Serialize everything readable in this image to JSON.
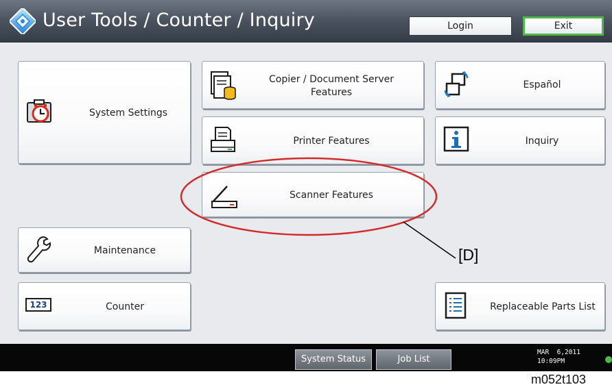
{
  "header": {
    "title": "User Tools / Counter / Inquiry",
    "logo_icon": "diamond-logo-icon",
    "login_label": "Login",
    "exit_label": "Exit",
    "exit_border_color": "#4fb848"
  },
  "menu": {
    "system_settings": {
      "label": "System Settings",
      "icon": "system-settings-icon"
    },
    "copier": {
      "label_line1": "Copier / Document Server",
      "label_line2": "Features",
      "icon": "copier-icon"
    },
    "printer": {
      "label": "Printer Features",
      "icon": "printer-icon"
    },
    "scanner": {
      "label": "Scanner Features",
      "icon": "scanner-icon"
    },
    "language": {
      "label": "Español",
      "icon": "language-switch-icon"
    },
    "inquiry": {
      "label": "Inquiry",
      "icon": "info-icon"
    },
    "maintenance": {
      "label": "Maintenance",
      "icon": "wrench-icon"
    },
    "counter": {
      "label": "Counter",
      "icon": "counter-123-icon",
      "icon_text": "123"
    },
    "parts": {
      "label": "Replaceable Parts List",
      "icon": "list-icon"
    }
  },
  "footer": {
    "system_status_label": "System Status",
    "job_list_label": "Job List",
    "date": "MAR  6,2011",
    "time": "10:09PM"
  },
  "annotation": {
    "callout_label": "[D]",
    "highlight_color": "#d42a2a"
  },
  "figure_id": "m052t103"
}
